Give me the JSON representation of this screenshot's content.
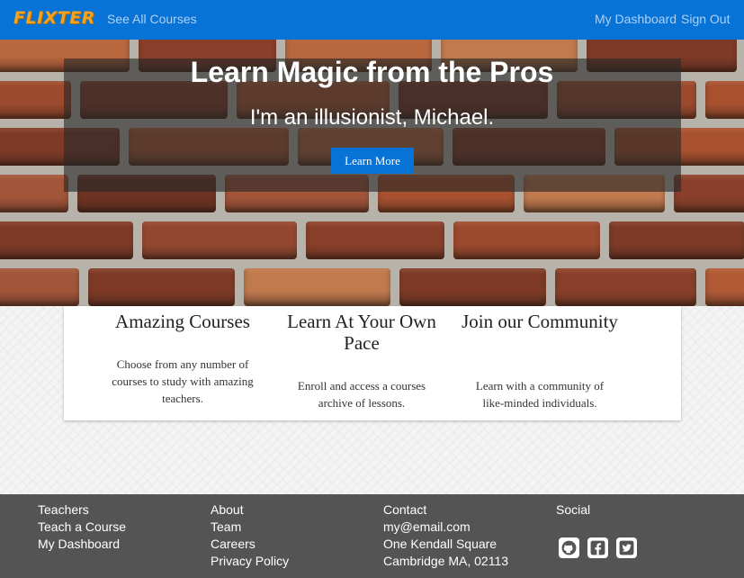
{
  "navbar": {
    "brand": "FLIXTER",
    "see_all_courses": "See All Courses",
    "my_dashboard": "My Dashboard",
    "sign_out": "Sign Out"
  },
  "hero": {
    "title": "Learn Magic from the Pros",
    "subtitle": "I'm an illusionist, Michael.",
    "button_label": "Learn More"
  },
  "features": [
    {
      "title": "Amazing Courses",
      "text": "Choose from any number of courses to study with amazing teachers."
    },
    {
      "title": "Learn At Your Own Pace",
      "text": "Enroll and access a courses archive of lessons."
    },
    {
      "title": "Join our Community",
      "text": "Learn with a community of like-minded individuals."
    }
  ],
  "footer": {
    "teachers": {
      "heading": "Teachers",
      "links": [
        "Teach a Course",
        "My Dashboard"
      ]
    },
    "about": {
      "heading": "About",
      "links": [
        "Team",
        "Careers",
        "Privacy Policy"
      ]
    },
    "contact": {
      "heading": "Contact",
      "lines": [
        "my@email.com",
        "One Kendall Square",
        "Cambridge MA, 02113"
      ]
    },
    "social": {
      "heading": "Social",
      "icons": [
        "github-icon",
        "facebook-icon",
        "twitter-icon"
      ]
    }
  },
  "colors": {
    "navbar": "#0873d6",
    "brand": "#f4a321",
    "footer": "#555454",
    "button": "#0873d6"
  }
}
